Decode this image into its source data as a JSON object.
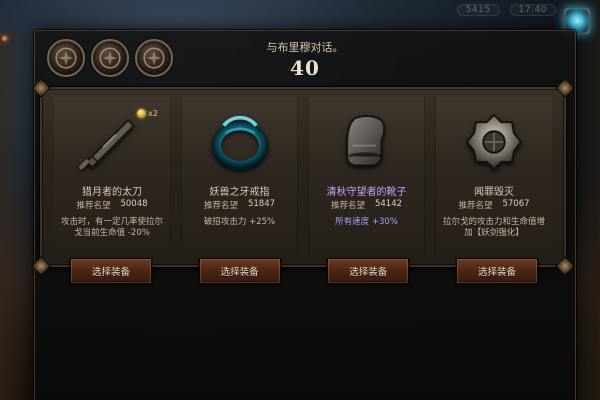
{
  "dialog": {
    "title": "与布里穆对话。",
    "count": "40"
  },
  "hud": {
    "left_text": "5415",
    "right_text": "17:40"
  },
  "medals": [
    {
      "icon": "medal-icon"
    },
    {
      "icon": "medal-icon"
    },
    {
      "icon": "medal-icon"
    }
  ],
  "items": [
    {
      "name": "猎月者的太刀",
      "rep_label": "推荐名望",
      "rep_value": "50048",
      "qty": "x2",
      "effect": "攻击时，有一定几率使拉尔戈当前生命值 -20%",
      "theme": "sword"
    },
    {
      "name": "妖兽之牙戒指",
      "rep_label": "推荐名望",
      "rep_value": "51847",
      "effect": "破招攻击力 +25%",
      "theme": "ring"
    },
    {
      "name": "清秋守望者的靴子",
      "rep_label": "推荐名望",
      "rep_value": "54142",
      "effect": "所有速度 +30%",
      "theme": "boots"
    },
    {
      "name": "闻罪毁灭",
      "rep_label": "推荐名望",
      "rep_value": "57067",
      "effect": "拉尔戈的攻击力和生命值增加【妖剑强化】",
      "theme": "helm"
    }
  ],
  "buttons": [
    {
      "label": "选择装备"
    },
    {
      "label": "选择装备"
    },
    {
      "label": "选择装备"
    },
    {
      "label": "选择装备"
    }
  ],
  "colors": {
    "accent_gold": "#d6c7aa",
    "item_purple": "#c8a4ff",
    "button_red": "#4c2515"
  }
}
